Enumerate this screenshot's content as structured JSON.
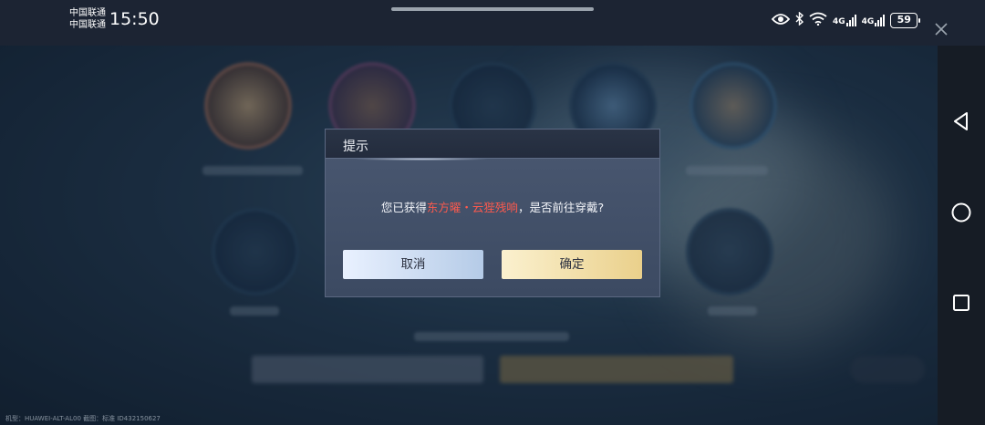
{
  "status_bar": {
    "carrier_1": "中国联通",
    "carrier_2": "中国联通",
    "time": "15:50",
    "network_1": "4G",
    "network_2": "4G",
    "battery": "59"
  },
  "icons": {
    "eye": "eye-icon",
    "bluetooth": "bluetooth-icon",
    "wifi": "wifi-icon",
    "close": "close-icon",
    "back": "back-triangle-icon",
    "home": "home-circle-icon",
    "recents": "recents-square-icon"
  },
  "dialog": {
    "title": "提示",
    "message_prefix": "您已获得",
    "message_highlight": "东方曜・云狴残响",
    "message_suffix": "，是否前往穿戴?",
    "cancel_label": "取消",
    "confirm_label": "确定"
  },
  "watermark": "机型：HUAWEI-ALT-AL00 截图：标准 ID432150627",
  "colors": {
    "highlight": "#ff5a4d",
    "cancel_button": "#d3e2f6",
    "confirm_button": "#f3e0ad",
    "dialog_bg": "#434f68"
  }
}
